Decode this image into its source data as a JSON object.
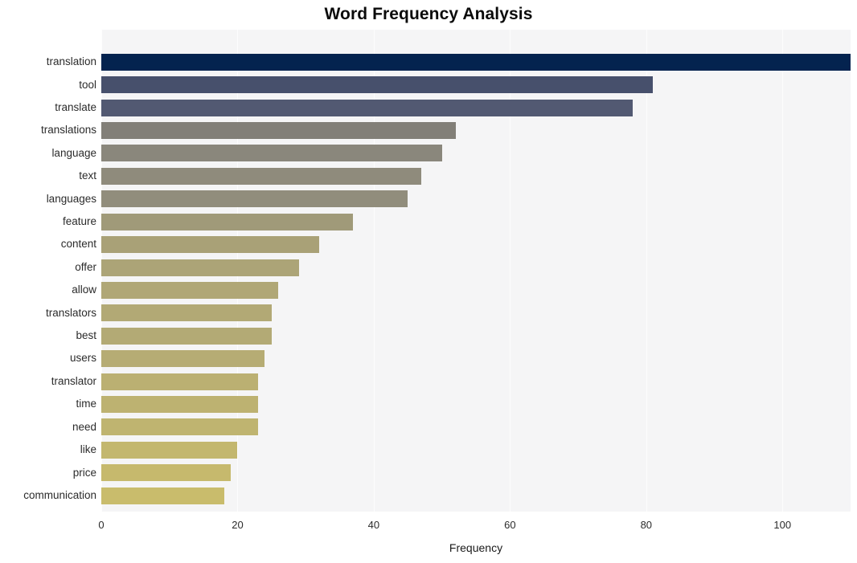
{
  "chart_data": {
    "type": "bar",
    "orientation": "horizontal",
    "title": "Word Frequency Analysis",
    "xlabel": "Frequency",
    "ylabel": "",
    "xlim": [
      0,
      110
    ],
    "ylim": null,
    "grid": true,
    "legend": null,
    "xticks": [
      0,
      20,
      40,
      60,
      80,
      100
    ],
    "xtick_labels": [
      "0",
      "20",
      "40",
      "60",
      "80",
      "100"
    ],
    "categories": [
      "translation",
      "tool",
      "translate",
      "translations",
      "language",
      "text",
      "languages",
      "feature",
      "content",
      "offer",
      "allow",
      "translators",
      "best",
      "users",
      "translator",
      "time",
      "need",
      "like",
      "price",
      "communication"
    ],
    "values": [
      110,
      81,
      78,
      52,
      50,
      47,
      45,
      37,
      32,
      29,
      26,
      25,
      25,
      24,
      23,
      23,
      23,
      20,
      19,
      18
    ],
    "bar_colors": [
      "#04234f",
      "#47506c",
      "#525972",
      "#827f78",
      "#8a877c",
      "#8f8b7c",
      "#918d7c",
      "#a09a79",
      "#a9a177",
      "#aca477",
      "#b0a776",
      "#b2a975",
      "#b3aa75",
      "#b6ac74",
      "#bbb072",
      "#bdb271",
      "#bfb470",
      "#c3b76e",
      "#c6b96d",
      "#c9bc6c"
    ],
    "plot_background": "#f5f5f6",
    "gridline_color": "#fdfdfd",
    "figure_background": "#ffffff"
  },
  "axes": {
    "x_axis_title": "Frequency"
  }
}
